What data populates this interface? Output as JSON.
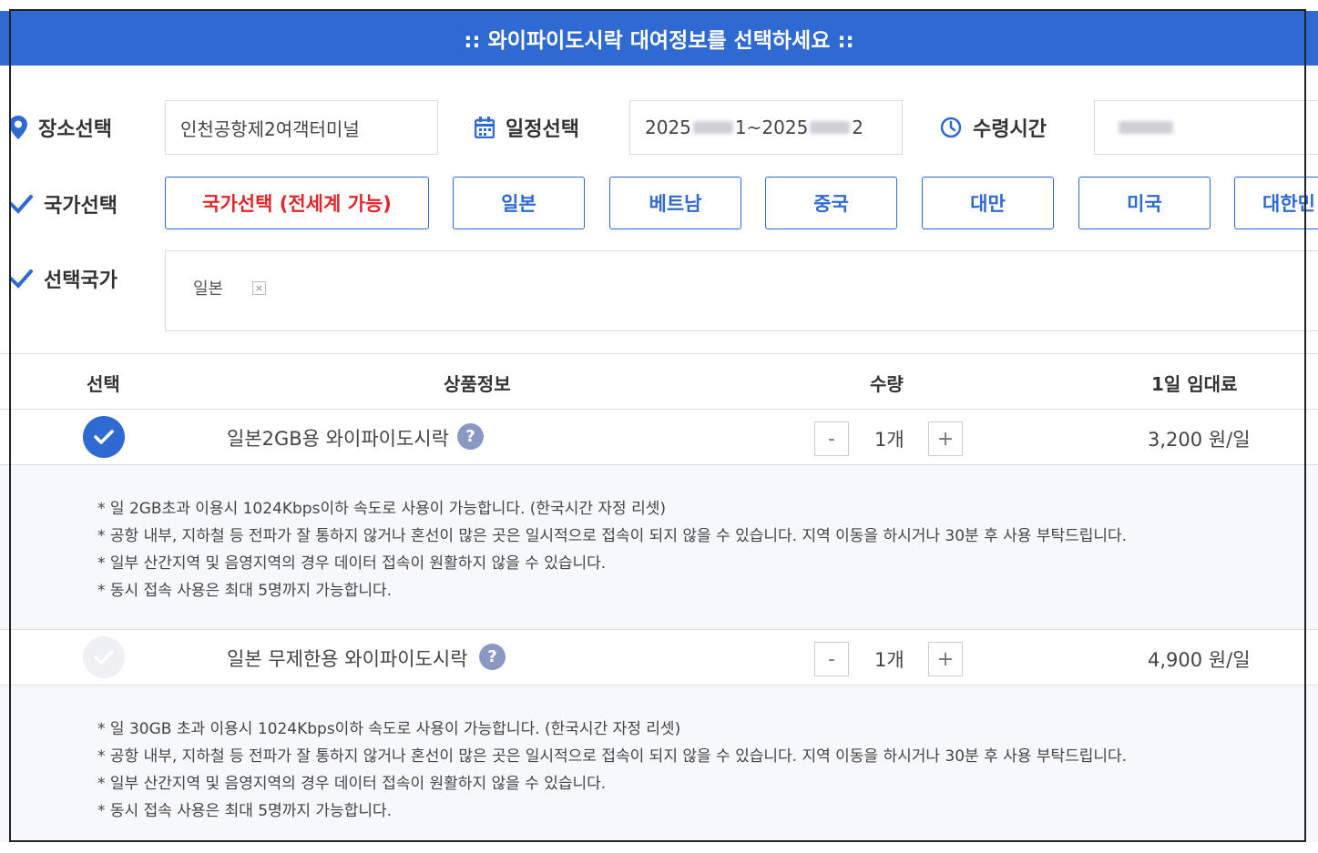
{
  "header": {
    "title": ":: 와이파이도시락 대여정보를 선택하세요 ::"
  },
  "colors": {
    "accent": "#2f6ad3",
    "highlight": "#e2262b"
  },
  "place": {
    "label": "장소선택",
    "value": "인천공항제2여객터미널"
  },
  "schedule": {
    "label": "일정선택",
    "value_prefix": "2025",
    "value_mid": "1~2025",
    "value_suffix": "2"
  },
  "pickup": {
    "label": "수령시간"
  },
  "country": {
    "label": "국가선택",
    "buttons": [
      "국가선택 (전세계 가능)",
      "일본",
      "베트남",
      "중국",
      "대만",
      "미국",
      "대한민"
    ]
  },
  "selected": {
    "label": "선택국가",
    "chips": [
      {
        "name": "일본",
        "remove": "×"
      }
    ]
  },
  "table": {
    "headers": [
      "선택",
      "상품정보",
      "수량",
      "1일 임대료"
    ],
    "products": [
      {
        "name": "일본2GB용 와이파이도시락",
        "help": "?",
        "qty": "1개",
        "minus": "-",
        "plus": "+",
        "price": "3,200 원/일",
        "selected": true,
        "notes": [
          "* 일 2GB초과 이용시 1024Kbps이하 속도로 사용이 가능합니다. (한국시간 자정 리셋)",
          "* 공항 내부, 지하철 등 전파가 잘 통하지 않거나 혼선이 많은 곳은 일시적으로 접속이 되지 않을 수 있습니다. 지역 이동을 하시거나 30분 후 사용 부탁드립니다.",
          "* 일부 산간지역 및 음영지역의 경우 데이터 접속이 원활하지 않을 수 있습니다.",
          "* 동시 접속 사용은 최대 5명까지 가능합니다."
        ]
      },
      {
        "name": "일본 무제한용 와이파이도시락",
        "help": "?",
        "qty": "1개",
        "minus": "-",
        "plus": "+",
        "price": "4,900 원/일",
        "selected": false,
        "notes": [
          "* 일 30GB 초과 이용시 1024Kbps이하 속도로 사용이 가능합니다. (한국시간 자정 리셋)",
          "* 공항 내부, 지하철 등 전파가 잘 통하지 않거나 혼선이 많은 곳은 일시적으로 접속이 되지 않을 수 있습니다. 지역 이동을 하시거나 30분 후 사용 부탁드립니다.",
          "* 일부 산간지역 및 음영지역의 경우 데이터 접속이 원활하지 않을 수 있습니다.",
          "* 동시 접속 사용은 최대 5명까지 가능합니다."
        ]
      }
    ]
  }
}
